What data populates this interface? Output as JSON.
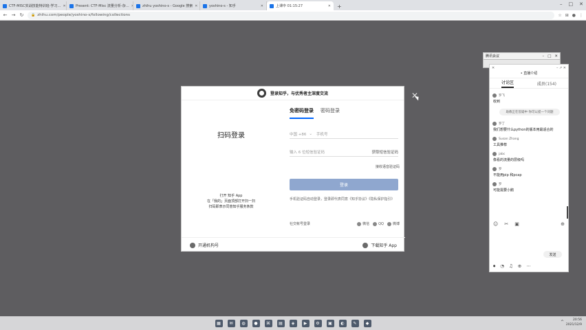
{
  "browser": {
    "tabs": [
      {
        "title": "CTF-MISC实战技能特训班-学习…",
        "active": false
      },
      {
        "title": "Present: CTF-Misc 流量分析-杂…",
        "active": false
      },
      {
        "title": "zhihu yoshino-s - Google 搜索",
        "active": false
      },
      {
        "title": "yoshino-s - 知乎",
        "active": false
      },
      {
        "title": "上课中 01:15:27",
        "active": true
      }
    ],
    "new_tab": "+",
    "url": "zhihu.com/people/yoshino-s/following/collections",
    "window_controls": [
      "–",
      "□",
      "✕"
    ]
  },
  "login_modal": {
    "banner": "登录知乎，与优秀者主深度交流",
    "qr_title": "扫码登录",
    "qr_hint_lines": [
      "打开 知乎 App",
      "在「我的」页面顶部打开扫一扫",
      "扫码即表示同意知乎服务条款"
    ],
    "tabs": [
      "免密码登录",
      "密码登录"
    ],
    "country_code": "中国 +86",
    "phone_placeholder": "手机号",
    "sms_placeholder": "输入 6 位短信验证码",
    "get_sms_code": "获取短信验证码",
    "voice_code": "接收语音验证码",
    "login_button": "登录",
    "agreement": "手机验证码自动登录，登录即代表同意《知乎协议》《隐私保护指引》",
    "social_label": "社交帐号登录",
    "social": [
      "微信",
      "QQ",
      "微博"
    ],
    "footer_left": "开通机构号",
    "footer_right": "下载知乎 App",
    "close": "✕"
  },
  "share_toolbar": {
    "title": "腾讯会议",
    "controls": [
      "–",
      "□",
      "✕"
    ]
  },
  "chat_panel": {
    "top_left": "✕",
    "top_icons": "– ↗ ✕",
    "header": "• 直播介绍",
    "tabs": [
      "讨论区",
      "成员(154)"
    ],
    "messages": [
      {
        "user": "罗飞",
        "text": "收到"
      },
      {
        "user": "罗丁",
        "text": "我们想要什么python的版本用最适合的"
      },
      {
        "user": "Susan Zhang",
        "text": "工具推荐"
      },
      {
        "user": "jabc",
        "text": "像看的流量的层级吗"
      },
      {
        "user": "罗",
        "text": "不能用pip 和pcap"
      },
      {
        "user": "罗",
        "text": "可能需要小鹅"
      }
    ],
    "system_notice": "助教正在答疑中 你可以提一个问题",
    "bottom_icons": [
      "☺",
      "✂",
      "▣",
      "⊕"
    ],
    "send": "发送",
    "footer_icons": [
      "⏺",
      "◔",
      "♫",
      "⊕",
      "⋯"
    ]
  },
  "taskbar": {
    "apps": [
      "▦",
      "✉",
      "◍",
      "●",
      "⌘",
      "▤",
      "◈",
      "▶",
      "⚙",
      "▣",
      "◐",
      "✎",
      "◆"
    ],
    "tray_arrow": "^",
    "time": "20:56",
    "date": "2021/12/9"
  }
}
